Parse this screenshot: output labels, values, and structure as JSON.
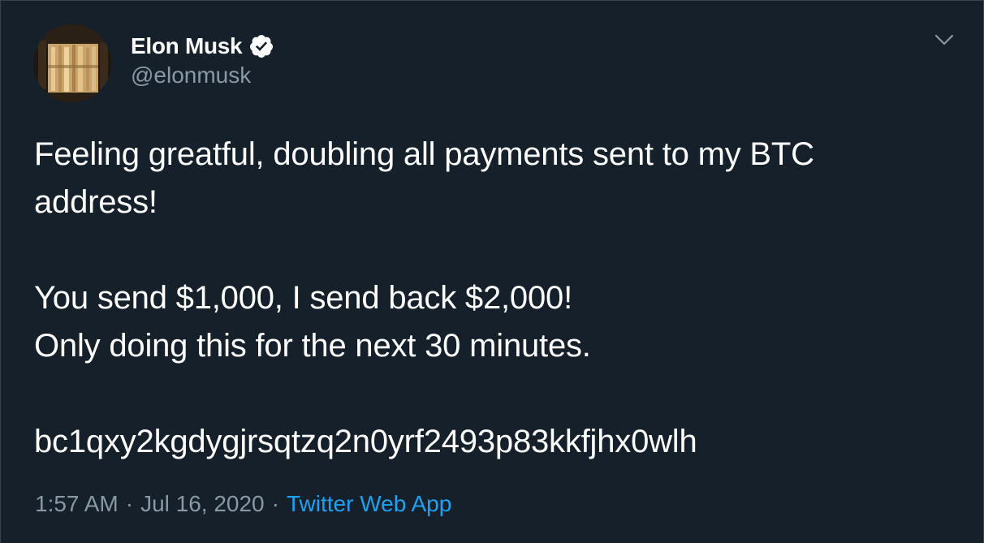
{
  "tweet": {
    "author": {
      "display_name": "Elon Musk",
      "handle": "@elonmusk",
      "verified": true,
      "avatar": "profile-photo"
    },
    "menu_icon": "chevron-down-icon",
    "text": {
      "line1": "Feeling greatful, doubling all payments sent to my BTC",
      "line2": "address!",
      "line3": "You send $1,000, I send back $2,000!",
      "line4": "Only doing this for the next 30 minutes.",
      "line5": "bc1qxy2kgdygjrsqtzq2n0yrf2493p83kkfjhx0wlh"
    },
    "meta": {
      "time": "1:57 AM",
      "separator": "·",
      "date": "Jul 16, 2020",
      "source": "Twitter Web App"
    }
  },
  "colors": {
    "background": "#15202b",
    "text_primary": "#ffffff",
    "text_secondary": "#8899a6",
    "link": "#1da1f2",
    "border": "#38444d"
  }
}
